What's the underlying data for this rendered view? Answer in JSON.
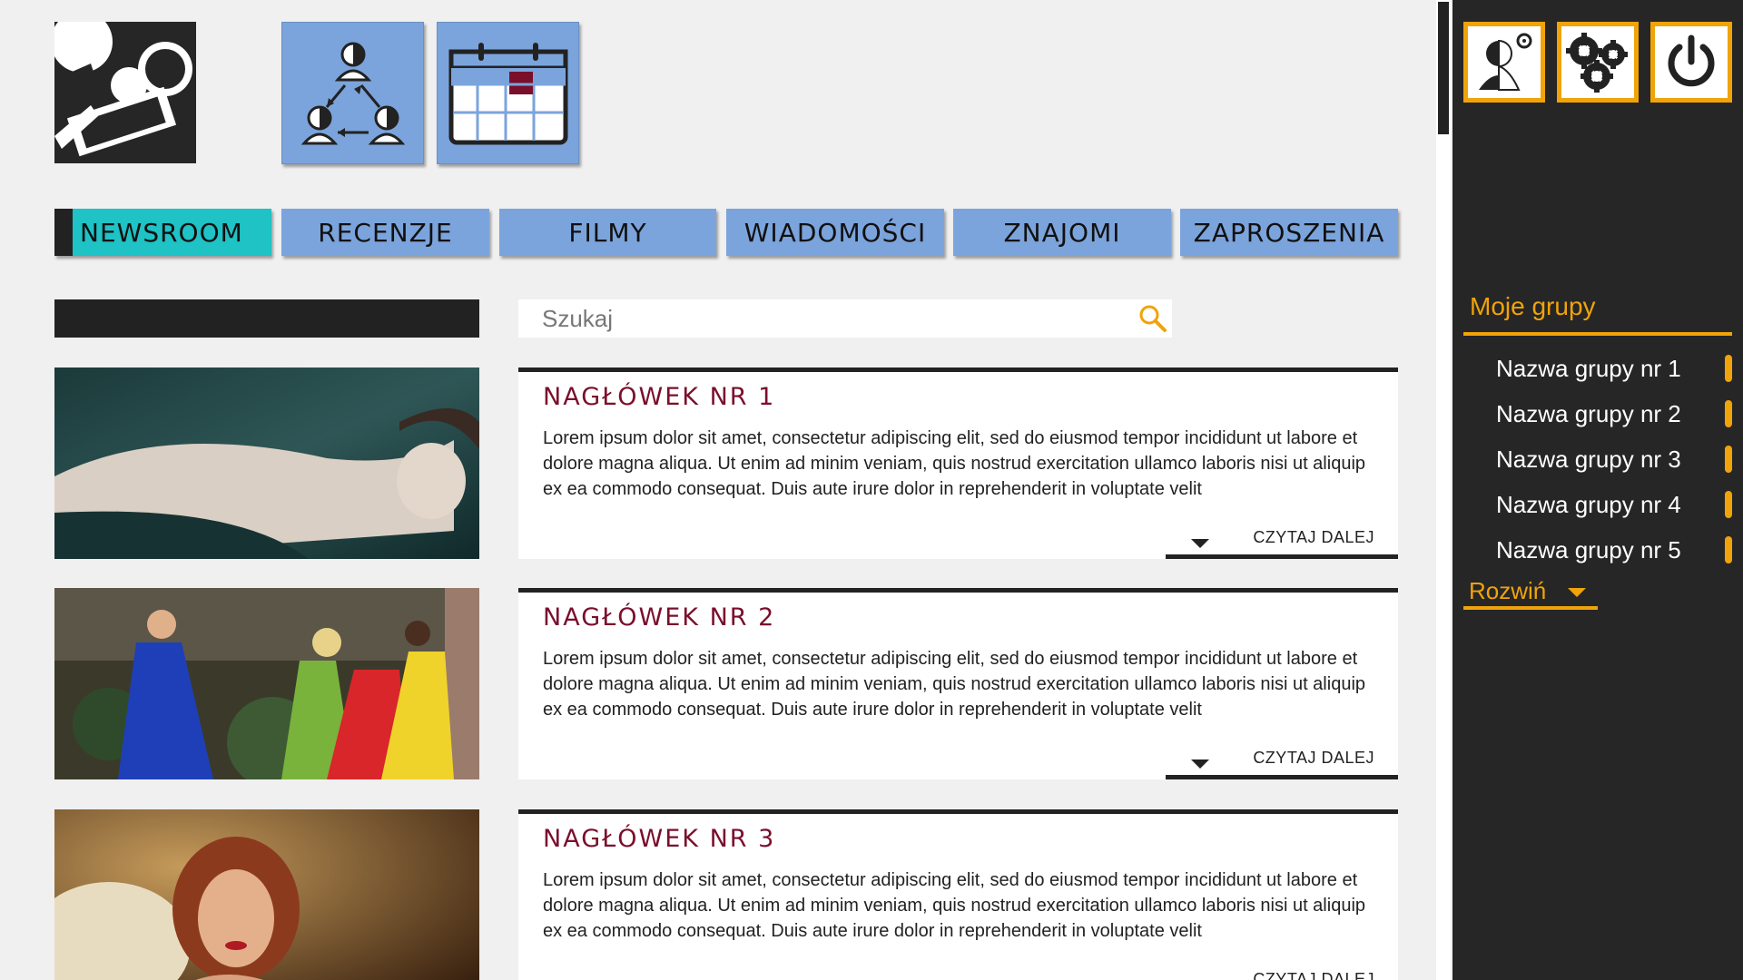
{
  "header": {
    "logo": "logo-icon",
    "tiles": [
      {
        "icon": "group-exchange-icon"
      },
      {
        "icon": "calendar-icon"
      }
    ]
  },
  "nav": {
    "items": [
      "NEWSROOM",
      "RECENZJE",
      "FILMY",
      "WIADOMOŚCI",
      "ZNAJOMI",
      "ZAPROSZENIA"
    ],
    "active": "NEWSROOM"
  },
  "search": {
    "placeholder": "Szukaj",
    "value": ""
  },
  "articles": [
    {
      "title": "NAGŁÓWEK  NR  1",
      "body": "Lorem ipsum dolor sit amet, consectetur adipiscing elit, sed do eiusmod tempor incididunt ut labore et dolore magna aliqua. Ut enim ad minim veniam, quis nostrud exercitation ullamco laboris nisi ut aliquip ex ea commodo consequat. Duis aute irure dolor in reprehenderit in voluptate velit",
      "read_more": "CZYTAJ DALEJ"
    },
    {
      "title": "NAGŁÓWEK  NR  2",
      "body": "Lorem ipsum dolor sit amet, consectetur adipiscing elit, sed do eiusmod tempor incididunt ut labore et dolore magna aliqua. Ut enim ad minim veniam, quis nostrud exercitation ullamco laboris nisi ut aliquip ex ea commodo consequat. Duis aute irure dolor in reprehenderit in voluptate velit",
      "read_more": "CZYTAJ DALEJ"
    },
    {
      "title": "NAGŁÓWEK  NR  3",
      "body": "Lorem ipsum dolor sit amet, consectetur adipiscing elit, sed do eiusmod tempor incididunt ut labore et dolore magna aliqua. Ut enim ad minim veniam, quis nostrud exercitation ullamco laboris nisi ut aliquip ex ea commodo consequat. Duis aute irure dolor in reprehenderit in voluptate velit",
      "read_more": "CZYTAJ DALEJ"
    }
  ],
  "sidebar": {
    "buttons": [
      "profile-settings-icon",
      "settings-icon",
      "power-icon"
    ],
    "groups_title": "Moje grupy",
    "groups": [
      "Nazwa grupy nr 1",
      "Nazwa grupy nr 2",
      "Nazwa grupy nr 3",
      "Nazwa grupy nr 4",
      "Nazwa grupy nr 5"
    ],
    "expand_label": "Rozwiń"
  },
  "colors": {
    "accent": "#f0a30a",
    "nav": "#7ba4dc",
    "nav_active": "#1fc2c5",
    "heading": "#7a0f2c",
    "sidebar_bg": "#262626"
  }
}
